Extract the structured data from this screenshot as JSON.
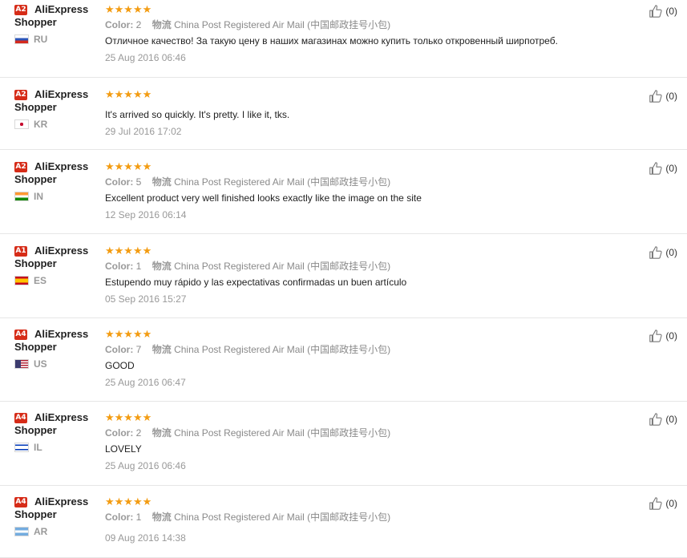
{
  "reviews": [
    {
      "level": "A2",
      "user_name_1": "AliExpress",
      "user_name_2": "Shopper",
      "country": "RU",
      "flag": "ru",
      "stars": "★★★★★",
      "color_label": "Color:",
      "color_value": "2",
      "shipping_label": "物流",
      "shipping_value": "China Post Registered Air Mail (中国邮政挂号小包)",
      "text": "Отличное качество! За такую цену в наших магазинах можно купить только откровенный ширпотреб.",
      "date": "25 Aug 2016 06:46",
      "likes": "(0)"
    },
    {
      "level": "A2",
      "user_name_1": "AliExpress",
      "user_name_2": "Shopper",
      "country": "KR",
      "flag": "kr",
      "stars": "★★★★★",
      "color_label": "",
      "color_value": "",
      "shipping_label": "",
      "shipping_value": "",
      "text": "It's arrived so quickly. It's pretty. I like it, tks.",
      "date": "29 Jul 2016 17:02",
      "likes": "(0)"
    },
    {
      "level": "A2",
      "user_name_1": "AliExpress",
      "user_name_2": "Shopper",
      "country": "IN",
      "flag": "in",
      "stars": "★★★★★",
      "color_label": "Color:",
      "color_value": "5",
      "shipping_label": "物流",
      "shipping_value": "China Post Registered Air Mail (中国邮政挂号小包)",
      "text": "Excellent product very well finished looks exactly like the image on the site",
      "date": "12 Sep 2016 06:14",
      "likes": "(0)"
    },
    {
      "level": "A1",
      "user_name_1": "AliExpress",
      "user_name_2": "Shopper",
      "country": "ES",
      "flag": "es",
      "stars": "★★★★★",
      "color_label": "Color:",
      "color_value": "1",
      "shipping_label": "物流",
      "shipping_value": "China Post Registered Air Mail (中国邮政挂号小包)",
      "text": "Estupendo muy rápido y las expectativas confirmadas un buen artículo",
      "date": "05 Sep 2016 15:27",
      "likes": "(0)"
    },
    {
      "level": "A4",
      "user_name_1": "AliExpress",
      "user_name_2": "Shopper",
      "country": "US",
      "flag": "us",
      "stars": "★★★★★",
      "color_label": "Color:",
      "color_value": "7",
      "shipping_label": "物流",
      "shipping_value": "China Post Registered Air Mail (中国邮政挂号小包)",
      "text": "GOOD",
      "date": "25 Aug 2016 06:47",
      "likes": "(0)"
    },
    {
      "level": "A4",
      "user_name_1": "AliExpress",
      "user_name_2": "Shopper",
      "country": "IL",
      "flag": "il",
      "stars": "★★★★★",
      "color_label": "Color:",
      "color_value": "2",
      "shipping_label": "物流",
      "shipping_value": "China Post Registered Air Mail (中国邮政挂号小包)",
      "text": "LOVELY",
      "date": "25 Aug 2016 06:46",
      "likes": "(0)"
    },
    {
      "level": "A4",
      "user_name_1": "AliExpress",
      "user_name_2": "Shopper",
      "country": "AR",
      "flag": "ar",
      "stars": "★★★★★",
      "color_label": "Color:",
      "color_value": "1",
      "shipping_label": "物流",
      "shipping_value": "China Post Registered Air Mail (中国邮政挂号小包)",
      "text": "",
      "date": "09 Aug 2016 14:38",
      "likes": "(0)"
    }
  ],
  "colors": {
    "star": "#f39c12",
    "badge": "#d62c18",
    "divider": "#e6e6e6"
  }
}
